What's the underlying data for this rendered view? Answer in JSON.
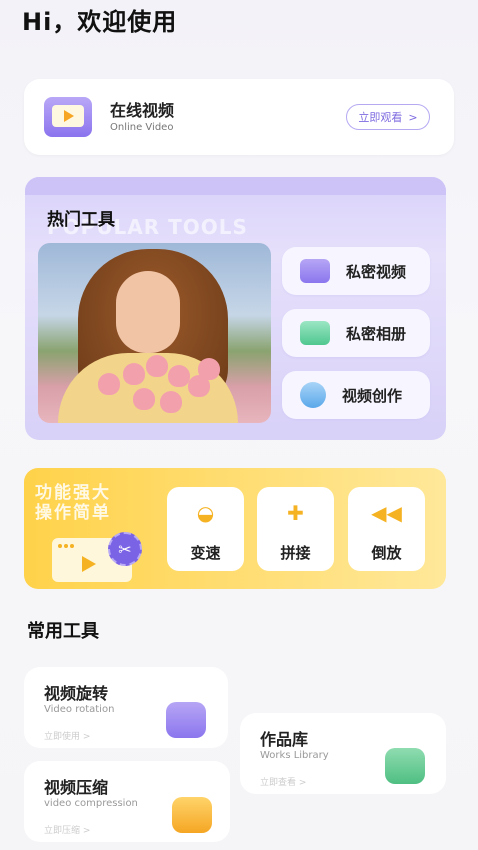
{
  "greeting": "Hi，欢迎使用",
  "online_video": {
    "title": "在线视频",
    "subtitle": "Online Video",
    "button": "立即观看",
    "button_arrow": ">"
  },
  "popular": {
    "title": "热门工具",
    "bg_text": "POPULAR TOOLS",
    "items": [
      {
        "label": "私密视频",
        "icon": "private-video-icon"
      },
      {
        "label": "私密相册",
        "icon": "private-album-icon"
      },
      {
        "label": "视频创作",
        "icon": "video-create-icon"
      }
    ]
  },
  "banner": {
    "slogan_line1": "功能强大",
    "slogan_line2": "操作简单",
    "tools": [
      {
        "label": "变速",
        "icon": "speed-icon"
      },
      {
        "label": "拼接",
        "icon": "puzzle-icon"
      },
      {
        "label": "倒放",
        "icon": "rewind-icon"
      }
    ]
  },
  "common": {
    "title": "常用工具",
    "items": [
      {
        "title": "视频旋转",
        "subtitle": "Video rotation",
        "action": "立即使用 >"
      },
      {
        "title": "作品库",
        "subtitle": "Works Library",
        "action": "立即查看 >"
      },
      {
        "title": "视频压缩",
        "subtitle": "video compression",
        "action": "立即压缩 >"
      }
    ]
  },
  "colors": {
    "accent_purple": "#7e6be0",
    "banner_yellow": "#ffd24a"
  }
}
